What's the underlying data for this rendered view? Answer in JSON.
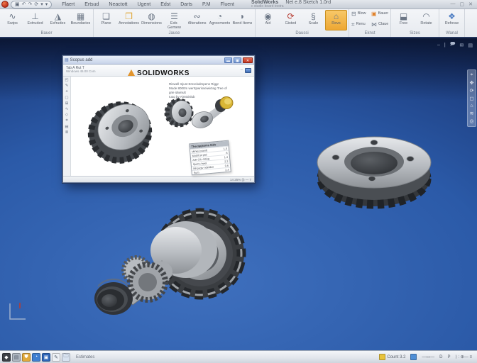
{
  "app": {
    "logo_color": "#c0321c",
    "qat_icons": [
      {
        "name": "save-icon",
        "glyph": "▣"
      },
      {
        "name": "undo-icon",
        "glyph": "↶"
      },
      {
        "name": "redo-icon",
        "glyph": "↷"
      },
      {
        "name": "rebuild-icon",
        "glyph": "⟳"
      },
      {
        "name": "options-arrow-icon",
        "glyph": "▾"
      },
      {
        "name": "expand-arrow-icon",
        "glyph": "▾"
      }
    ],
    "menus": [
      "Flaert",
      "Ertsud",
      "Neactott",
      "Ugent",
      "Edst",
      "Darts",
      "P.M",
      "Fluent"
    ],
    "title_left": "SolidWorks",
    "title_right": "Net e.8 Sketch 1.0rd",
    "title_sub": "c studio board        tootra",
    "window_buttons": [
      {
        "name": "minimize-button",
        "glyph": "—"
      },
      {
        "name": "restore-button",
        "glyph": "▢"
      },
      {
        "name": "close-button",
        "glyph": "✕"
      }
    ]
  },
  "ribbon": {
    "accent": "#eda733",
    "groups": [
      {
        "label": "Bauer",
        "items": [
          {
            "label": "Swips",
            "glyph": "∿",
            "icon": "sketch-icon"
          },
          {
            "label": "Extruded",
            "glyph": "⊥",
            "icon": "extrude-icon"
          },
          {
            "label": "Exfrudes",
            "glyph": "◮",
            "icon": "extrude-cut-icon"
          },
          {
            "label": "Boundaries",
            "glyph": "▦",
            "icon": "boundary-icon"
          }
        ]
      },
      {
        "label": "Jause",
        "items": [
          {
            "label": "Plane",
            "glyph": "❏",
            "icon": "plane-icon"
          },
          {
            "label": "Annotations",
            "glyph": "❒",
            "icon": "note-icon",
            "color": "#e0a93c"
          },
          {
            "label": "Dimensions",
            "glyph": "◍",
            "icon": "dimension-icon"
          },
          {
            "label": "Exb-Gemew",
            "glyph": "☰",
            "icon": "list-icon"
          },
          {
            "label": "Alterations",
            "glyph": "∾",
            "icon": "spline-icon"
          },
          {
            "label": "Agreements",
            "glyph": "◔",
            "icon": "arc-icon"
          },
          {
            "label": "Bend Items",
            "glyph": "◗",
            "icon": "fillet-icon"
          }
        ]
      },
      {
        "label": "Daussi",
        "items": [
          {
            "label": "Aid",
            "glyph": "◉",
            "icon": "aid-icon"
          },
          {
            "label": "Gisted",
            "glyph": "⟳",
            "icon": "mirror-icon",
            "color": "#b4352a"
          },
          {
            "label": "Scale",
            "glyph": "§",
            "icon": "scale-icon"
          },
          {
            "label": "Revs",
            "glyph": "⌂",
            "icon": "revolve-icon",
            "highlight": true
          }
        ]
      },
      {
        "label": "Eknst",
        "items": [
          {
            "label": "Blow",
            "glyph": "⊟",
            "icon": "blow-icon",
            "small": true
          },
          {
            "label": "Bauems",
            "glyph": "▣",
            "icon": "pattern-icon",
            "color": "#e0822c",
            "small": true
          },
          {
            "label": "Renu",
            "glyph": "⌗",
            "icon": "grid-icon",
            "small": true
          },
          {
            "label": "Clauers",
            "glyph": "⋈",
            "icon": "trim-icon",
            "small": true
          }
        ]
      },
      {
        "label": "Sizes",
        "items": [
          {
            "label": "Free",
            "glyph": "⬓",
            "icon": "free-icon"
          },
          {
            "label": "Rotate",
            "glyph": "◠",
            "icon": "rotate-icon"
          }
        ]
      },
      {
        "label": "Wanal",
        "items": [
          {
            "label": "Reforae",
            "glyph": "❖",
            "icon": "reference-icon",
            "color": "#4f7fc4"
          }
        ]
      }
    ]
  },
  "viewport": {
    "bg_center": "#3f70be",
    "bg_edge": "#14274f",
    "hud_icons": [
      {
        "name": "collapse-icon",
        "glyph": "–"
      },
      {
        "name": "divider",
        "glyph": "|"
      },
      {
        "name": "comment-icon",
        "glyph": "🗩"
      },
      {
        "name": "mail-icon",
        "glyph": "✉"
      },
      {
        "name": "sheet-icon",
        "glyph": "▤"
      }
    ],
    "side_toolbar_icons": [
      {
        "name": "select-icon",
        "glyph": "⌖"
      },
      {
        "name": "pan-icon",
        "glyph": "✥"
      },
      {
        "name": "rotate-view-icon",
        "glyph": "⟳"
      },
      {
        "name": "zoom-fit-icon",
        "glyph": "◻"
      },
      {
        "name": "home-view-icon",
        "glyph": "⌂"
      },
      {
        "name": "section-icon",
        "glyph": "≋"
      },
      {
        "name": "display-icon",
        "glyph": "◎"
      }
    ],
    "triad_axis_color": "#b8c4d6",
    "triad_tick_color": "#c0392b"
  },
  "float_window": {
    "title": "Scopus add",
    "buttons": [
      {
        "name": "window-minimize-button",
        "glyph": "▬"
      },
      {
        "name": "window-maximize-button",
        "glyph": "▣"
      },
      {
        "name": "window-close-button",
        "glyph": "✕",
        "close": true
      }
    ],
    "toolbar_line1": "Tab    A    Rut    T",
    "toolbar_line2": "Windows   45.00   Com",
    "logo_text": "SOLIDWORKS",
    "logo_mark_color": "#e2952d",
    "sidebar_icons": [
      {
        "name": "open-icon",
        "glyph": "◰"
      },
      {
        "name": "edit-icon",
        "glyph": "✎"
      },
      {
        "name": "target-icon",
        "glyph": "⌖"
      },
      {
        "name": "box-icon",
        "glyph": "▢"
      },
      {
        "name": "add-icon",
        "glyph": "⊞"
      },
      {
        "name": "curve-icon",
        "glyph": "∿"
      },
      {
        "name": "diamond-icon",
        "glyph": "◇"
      },
      {
        "name": "mesh-icon",
        "glyph": "⌗"
      },
      {
        "name": "notes-icon",
        "glyph": "▤"
      },
      {
        "name": "layers-icon",
        "glyph": "≣"
      }
    ],
    "doc_lines": [
      "Riswell Injust Emsckalmpens Riggr",
      "Mode 8000m werrtpwrisseiwicteg Tree of grie idwinult",
      "Iuoq by Aimtsinlub"
    ],
    "table": {
      "title": "Thecspjssms Side",
      "rows": [
        {
          "label": "Mfrkej brandt",
          "value": "1.0"
        },
        {
          "label": "ModiCal plal",
          "value": "8"
        },
        {
          "label": "AIR GIL drting",
          "value": "1.4"
        },
        {
          "label": "Sjemo hwel",
          "value": "2.2"
        },
        {
          "label": "Mhpsqtv ndefdne",
          "value": "0.6"
        },
        {
          "label": "Sum",
          "value": "2.4"
        }
      ]
    },
    "status_right": "14    25%    (i)    —    7"
  },
  "statusbar": {
    "left_icons": [
      {
        "name": "start-icon",
        "glyph": "◆",
        "bg": "#3b3f46"
      },
      {
        "name": "explorer-icon",
        "glyph": "▤",
        "bg": "#aeb6c0"
      },
      {
        "name": "shield-icon",
        "glyph": "⛊",
        "bg": "#e0a93c"
      },
      {
        "name": "browser-icon",
        "glyph": "◔",
        "bg": "#3f7fd1"
      },
      {
        "name": "media-icon",
        "glyph": "▣",
        "bg": "#2e66b8"
      },
      {
        "name": "pen-icon",
        "glyph": "✎",
        "bg": "#eef1f5"
      },
      {
        "name": "folder-icon",
        "glyph": "🗀",
        "bg": "#d8e2f0"
      }
    ],
    "left_text": "Estimates",
    "right_items": [
      {
        "name": "count-indicator",
        "glyph": "⊞",
        "icon_bg": "#e8c33c",
        "text": "Count 3.2"
      },
      {
        "name": "doc-indicator",
        "glyph": "▤",
        "icon_bg": "#4f8fd6",
        "text": ""
      },
      {
        "name": "slider-indicator",
        "glyph": "",
        "icon_bg": "",
        "text": "—▭—"
      },
      {
        "name": "d-indicator",
        "glyph": "",
        "icon_bg": "",
        "text": "D"
      },
      {
        "name": "p-indicator",
        "glyph": "",
        "icon_bg": "",
        "text": "P"
      },
      {
        "name": "misc-indicator",
        "glyph": "",
        "icon_bg": "",
        "text": "⟩ : ⊕— ≡"
      }
    ]
  }
}
